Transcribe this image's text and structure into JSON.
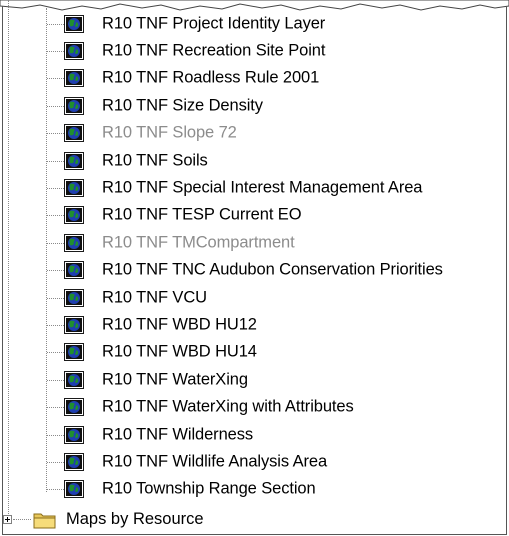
{
  "tree": {
    "layers": [
      {
        "label": "R10 TNF Project Identity Layer",
        "enabled": true
      },
      {
        "label": "R10 TNF Recreation Site Point",
        "enabled": true
      },
      {
        "label": "R10 TNF Roadless Rule 2001",
        "enabled": true
      },
      {
        "label": "R10 TNF Size Density",
        "enabled": true
      },
      {
        "label": "R10 TNF Slope 72",
        "enabled": false
      },
      {
        "label": "R10 TNF Soils",
        "enabled": true
      },
      {
        "label": "R10 TNF Special Interest Management Area",
        "enabled": true
      },
      {
        "label": "R10 TNF TESP Current EO",
        "enabled": true
      },
      {
        "label": "R10 TNF TMCompartment",
        "enabled": false
      },
      {
        "label": "R10 TNF TNC Audubon Conservation Priorities",
        "enabled": true
      },
      {
        "label": "R10 TNF VCU",
        "enabled": true
      },
      {
        "label": "R10 TNF WBD HU12",
        "enabled": true
      },
      {
        "label": "R10 TNF WBD HU14",
        "enabled": true
      },
      {
        "label": "R10 TNF WaterXing",
        "enabled": true
      },
      {
        "label": "R10 TNF WaterXing with Attributes",
        "enabled": true
      },
      {
        "label": "R10 TNF Wilderness",
        "enabled": true
      },
      {
        "label": "R10 TNF Wildlife Analysis Area",
        "enabled": true
      },
      {
        "label": "R10 Township Range Section",
        "enabled": true
      }
    ],
    "folder": {
      "label": "Maps by Resource",
      "expanded": false
    }
  },
  "icons": {
    "layer": "layer-globe-icon",
    "folder": "folder-icon",
    "expand": "expand-plus-icon"
  },
  "colors": {
    "text": "#000000",
    "disabled_text": "#8c8c8c",
    "globe_green": "#1f8f2e",
    "globe_blue": "#1f3fb0",
    "folder_yellow": "#f2d36b"
  }
}
